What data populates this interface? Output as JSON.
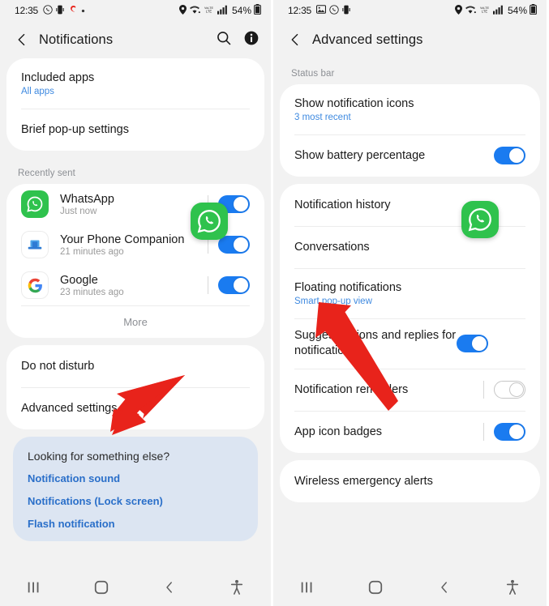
{
  "left": {
    "status": {
      "time": "12:35",
      "icons": [
        "whatsapp-icon",
        "vibrate-icon",
        "airtel-icon",
        "dot-icon"
      ],
      "right_icons": [
        "location-icon",
        "wifi-icon",
        "volte-icon",
        "signal-icon"
      ],
      "battery": "54%"
    },
    "title": "Notifications",
    "actions": [
      "search-icon",
      "info-icon"
    ],
    "card1": [
      {
        "title": "Included apps",
        "sub": "All apps"
      },
      {
        "title": "Brief pop-up settings",
        "sub": ""
      }
    ],
    "recently_sent_label": "Recently sent",
    "apps": [
      {
        "name": "WhatsApp",
        "time": "Just now",
        "icon": "whatsapp-icon",
        "toggle": "on"
      },
      {
        "name": "Your Phone Companion",
        "time": "21 minutes ago",
        "icon": "your-phone-companion-icon",
        "toggle": "on"
      },
      {
        "name": "Google",
        "time": "23 minutes ago",
        "icon": "google-icon",
        "toggle": "on"
      }
    ],
    "more_label": "More",
    "card3": [
      {
        "title": "Do not disturb"
      },
      {
        "title": "Advanced settings"
      }
    ],
    "looking": {
      "title": "Looking for something else?",
      "links": [
        "Notification sound",
        "Notifications (Lock screen)",
        "Flash notification"
      ]
    },
    "nav": [
      "recents-icon",
      "home-icon",
      "back-icon",
      "accessibility-icon"
    ]
  },
  "right": {
    "status": {
      "time": "12:35",
      "icons": [
        "image-icon",
        "whatsapp-icon",
        "vibrate-icon"
      ],
      "right_icons": [
        "location-icon",
        "wifi-icon",
        "volte-icon",
        "signal-icon"
      ],
      "battery": "54%"
    },
    "title": "Advanced settings",
    "status_bar_label": "Status bar",
    "card1": [
      {
        "title": "Show notification icons",
        "sub": "3 most recent",
        "toggle": "none"
      },
      {
        "title": "Show battery percentage",
        "sub": "",
        "toggle": "on"
      }
    ],
    "card2": [
      {
        "title": "Notification history",
        "sub": "",
        "toggle": "none"
      },
      {
        "title": "Conversations",
        "sub": "",
        "toggle": "none"
      },
      {
        "title": "Floating notifications",
        "sub": "Smart pop-up view",
        "toggle": "none"
      },
      {
        "title": "Suggest actions and replies for notifications",
        "sub": "",
        "toggle": "on"
      },
      {
        "title": "Notification reminders",
        "sub": "",
        "toggle": "off"
      },
      {
        "title": "App icon badges",
        "sub": "",
        "toggle": "on"
      }
    ],
    "card3": [
      {
        "title": "Wireless emergency alerts"
      }
    ],
    "nav": [
      "recents-icon",
      "home-icon",
      "back-icon",
      "accessibility-icon"
    ]
  },
  "colors": {
    "accent_blue": "#1a7bf0",
    "link_blue": "#3f8ae0",
    "arrow_red": "#e8231b",
    "whatsapp_green": "#2fc24d",
    "panel_bg": "#f2f2f2",
    "card_bg": "#ffffff",
    "hint_bg": "#dce5f2"
  }
}
